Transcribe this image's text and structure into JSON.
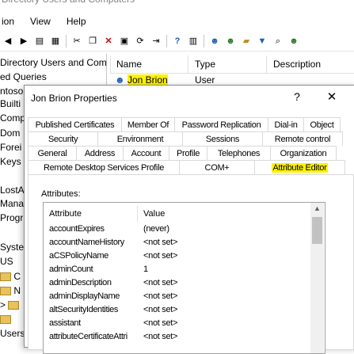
{
  "window": {
    "title": "Directory Users and Computers"
  },
  "menu": [
    "ion",
    "View",
    "Help"
  ],
  "tree": {
    "items": [
      "Directory Users and Com",
      "ed Queries",
      "ntoso.",
      "Builti",
      "Comp",
      "Dom",
      "Forei",
      "Keys",
      "LostA",
      "Mana",
      "Progr",
      "Syste",
      "US",
      "C",
      "N",
      "",
      "",
      "Users"
    ]
  },
  "list": {
    "columns": [
      "Name",
      "Type",
      "Description"
    ],
    "rows": [
      {
        "name": "Jon Brion",
        "type": "User"
      }
    ]
  },
  "dialog": {
    "title": "Jon Brion Properties",
    "help": "?",
    "close": "✕",
    "tabs_row1": [
      "Published Certificates",
      "Member Of",
      "Password Replication",
      "Dial-in",
      "Object"
    ],
    "tabs_row2": [
      "Security",
      "Environment",
      "Sessions",
      "Remote control"
    ],
    "tabs_row3": [
      "General",
      "Address",
      "Account",
      "Profile",
      "Telephones",
      "Organization"
    ],
    "tabs_row4": [
      "Remote Desktop Services Profile",
      "COM+",
      "Attribute Editor"
    ],
    "attributes_label": "Attributes:",
    "attr_header": {
      "name": "Attribute",
      "value": "Value"
    },
    "attributes": [
      {
        "name": "accountExpires",
        "value": "(never)"
      },
      {
        "name": "accountNameHistory",
        "value": "<not set>"
      },
      {
        "name": "aCSPolicyName",
        "value": "<not set>"
      },
      {
        "name": "adminCount",
        "value": "1"
      },
      {
        "name": "adminDescription",
        "value": "<not set>"
      },
      {
        "name": "adminDisplayName",
        "value": "<not set>"
      },
      {
        "name": "altSecurityIdentities",
        "value": "<not set>"
      },
      {
        "name": "assistant",
        "value": "<not set>"
      },
      {
        "name": "attributeCertificateAttri",
        "value": "<not set>"
      }
    ]
  },
  "colors": {
    "highlight": "#fff200",
    "border": "#d9d9d9"
  }
}
